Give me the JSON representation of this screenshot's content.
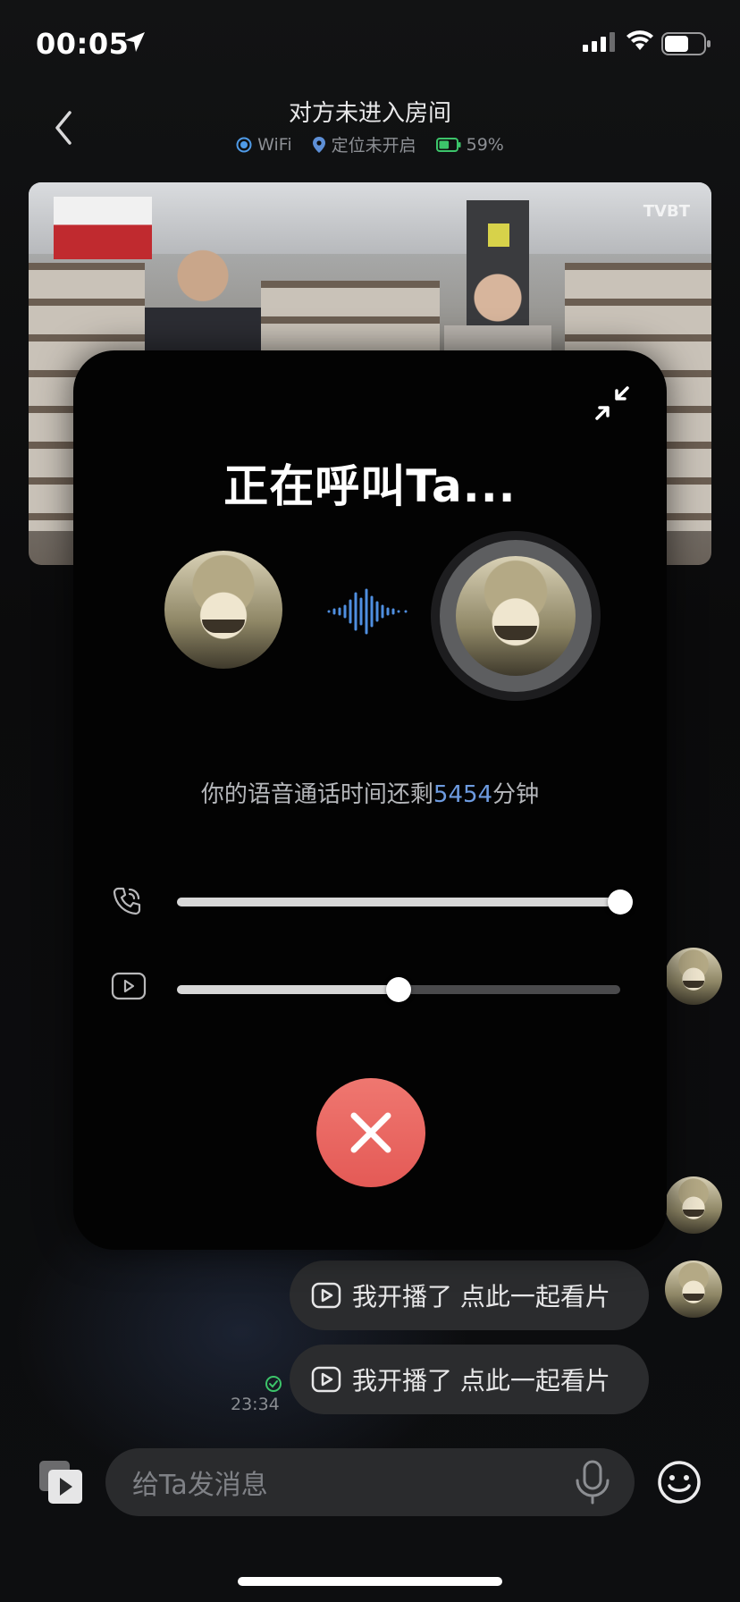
{
  "status_bar": {
    "time": "00:05",
    "battery_level": 0.62
  },
  "header": {
    "title": "对方未进入房间",
    "wifi_label": "WiFi",
    "location_label": "定位未开启",
    "battery_label": "59%",
    "battery_level": 0.59
  },
  "video": {
    "watermark": "TVBT"
  },
  "call": {
    "title": "正在呼叫Ta...",
    "remaining_prefix": "你的语音通话时间还剩",
    "remaining_minutes": "5454",
    "remaining_suffix": "分钟",
    "call_volume": 1.0,
    "video_volume": 0.5,
    "accent_color": "#6d9be0",
    "hangup_color": "#e8615b"
  },
  "messages": [
    {
      "text": "我开播了 点此一起看片",
      "icon": "play-square-icon"
    },
    {
      "text": "我开播了 点此一起看片",
      "icon": "play-square-icon"
    }
  ],
  "message_time": "23:34",
  "composer": {
    "placeholder": "给Ta发消息"
  }
}
